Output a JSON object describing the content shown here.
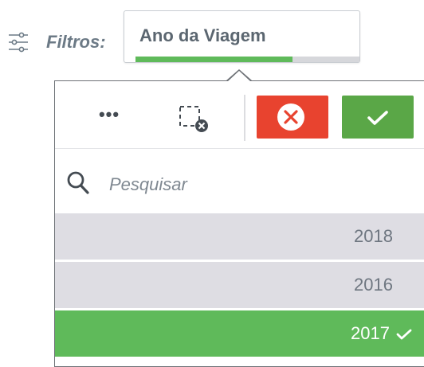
{
  "filters": {
    "label": "Filtros:",
    "icon": "sliders-icon"
  },
  "chip": {
    "title": "Ano da Viagem",
    "progress_fraction": 0.7
  },
  "toolbar": {
    "more": "•••",
    "more_icon": "more-options-icon",
    "deselect_icon": "clear-selection-icon",
    "cancel_icon": "cancel-x-icon",
    "confirm_icon": "confirm-check-icon",
    "colors": {
      "cancel": "#e8432f",
      "confirm": "#5aa747"
    }
  },
  "search": {
    "placeholder": "Pesquisar",
    "icon": "search-icon"
  },
  "list": {
    "items": [
      {
        "label": "2018",
        "state": "alternative"
      },
      {
        "label": "2016",
        "state": "alternative"
      },
      {
        "label": "2017",
        "state": "selected"
      }
    ],
    "colors": {
      "selected": "#5fba5a",
      "alternative": "#dedde3"
    }
  }
}
